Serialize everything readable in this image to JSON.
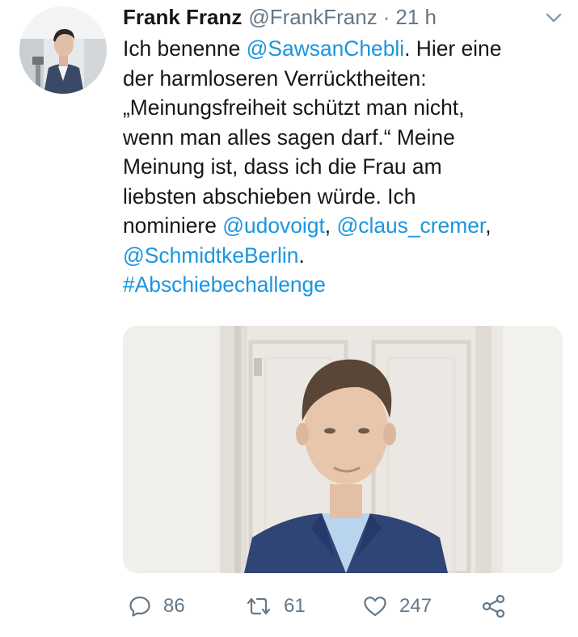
{
  "tweet": {
    "author": {
      "display_name": "Frank Franz",
      "handle": "@FrankFranz",
      "separator": "·",
      "time": "21 h"
    },
    "text": {
      "line1_pre": "Ich benenne ",
      "line1_mention": "@SawsanChebli",
      "line1_post": ". Hier eine",
      "line2": "der harmloseren Verrücktheiten:",
      "line3": "„Meinungsfreiheit schützt man nicht,",
      "line4": "wenn man alles sagen darf.“ Meine",
      "line5": "Meinung ist, dass ich die Frau am",
      "line6": "liebsten abschieben würde. Ich",
      "line7_pre": "nominiere ",
      "line7_mention1": "@udovoigt",
      "line7_sep": ", ",
      "line7_mention2": "@claus_cremer",
      "line7_post": ",",
      "line8_mention": "@SchmidtkeBerlin",
      "line8_post": ".",
      "line9_hashtag": "#Abschiebechallenge"
    },
    "actions": {
      "replies": "86",
      "retweets": "61",
      "likes": "247"
    }
  },
  "icons": {
    "menu": "chevron-down-icon",
    "reply": "reply-icon",
    "retweet": "retweet-icon",
    "like": "heart-icon",
    "share": "share-icon"
  },
  "colors": {
    "text": "#14171a",
    "secondary": "#657786",
    "link": "#1b95e0",
    "background": "#ffffff"
  }
}
